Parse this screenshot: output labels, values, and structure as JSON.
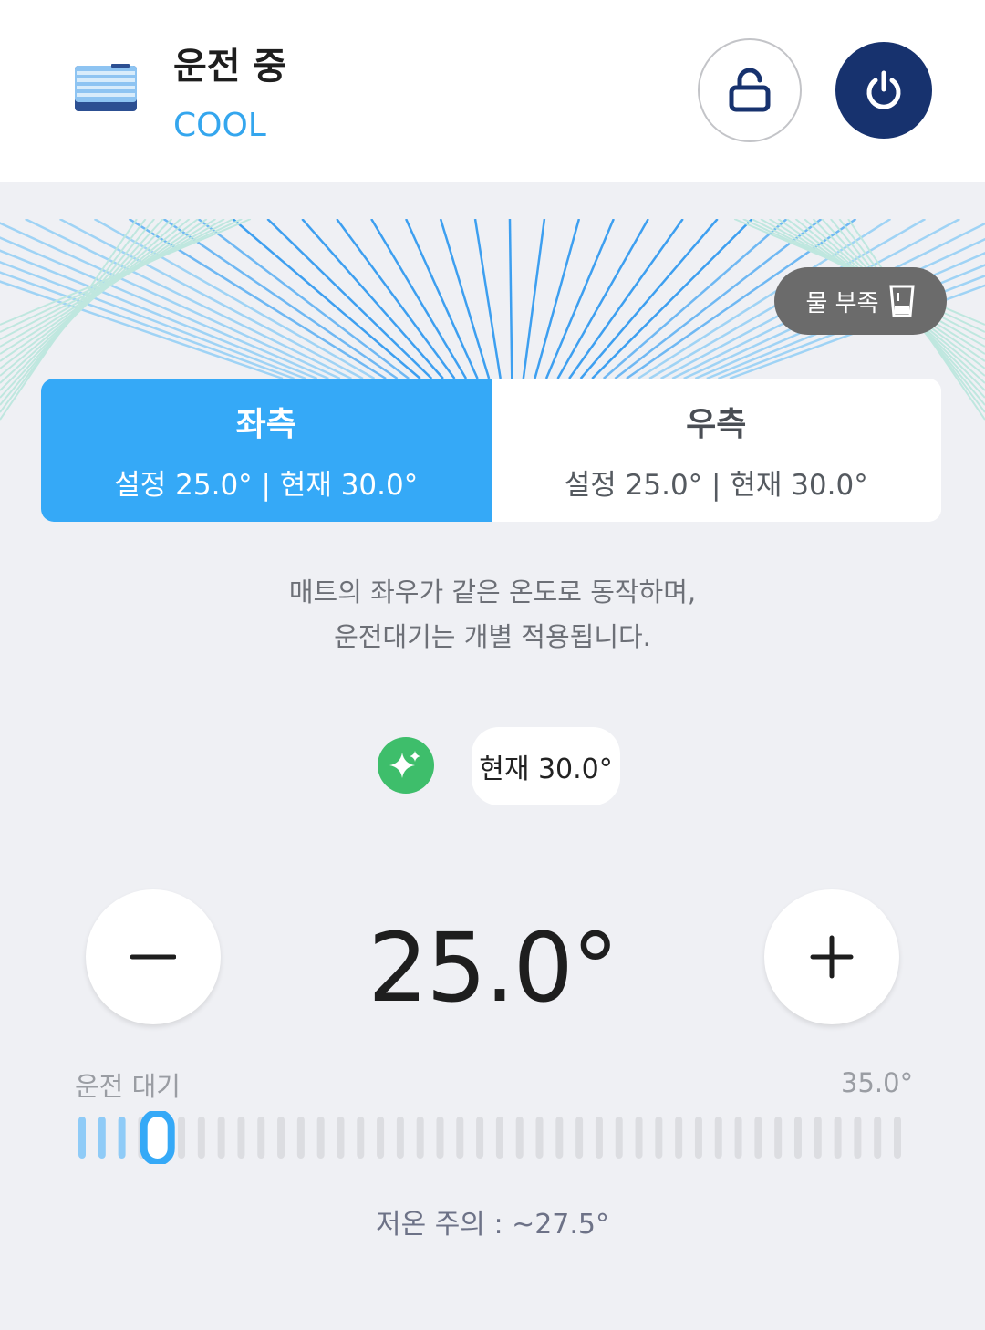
{
  "header": {
    "status_title": "운전 중",
    "mode": "COOL",
    "lock_icon": "unlock-icon",
    "power_icon": "power-icon"
  },
  "water_badge": {
    "label": "물 부족",
    "icon": "water-cup-icon"
  },
  "side_tabs": [
    {
      "name": "좌측",
      "detail": "설정 25.0° | 현재 30.0°",
      "active": true
    },
    {
      "name": "우측",
      "detail": "설정 25.0° | 현재 30.0°",
      "active": false
    }
  ],
  "info": {
    "line1": "매트의 좌우가 같은 온도로 동작하며,",
    "line2": "운전대기는 개별 적용됩니다."
  },
  "current": {
    "icon": "ai-sparkle-icon",
    "label": "현재 30.0°"
  },
  "set_temperature": "25.0°",
  "slider": {
    "min_label": "운전 대기",
    "max_label": "35.0°",
    "level": 0.05
  },
  "warning": "저온 주의 : ~27.5°",
  "colors": {
    "accent": "#35a9f7",
    "mode_text": "#34a6ee",
    "power_bg": "#17326e",
    "ai_green": "#3ebe6b"
  }
}
